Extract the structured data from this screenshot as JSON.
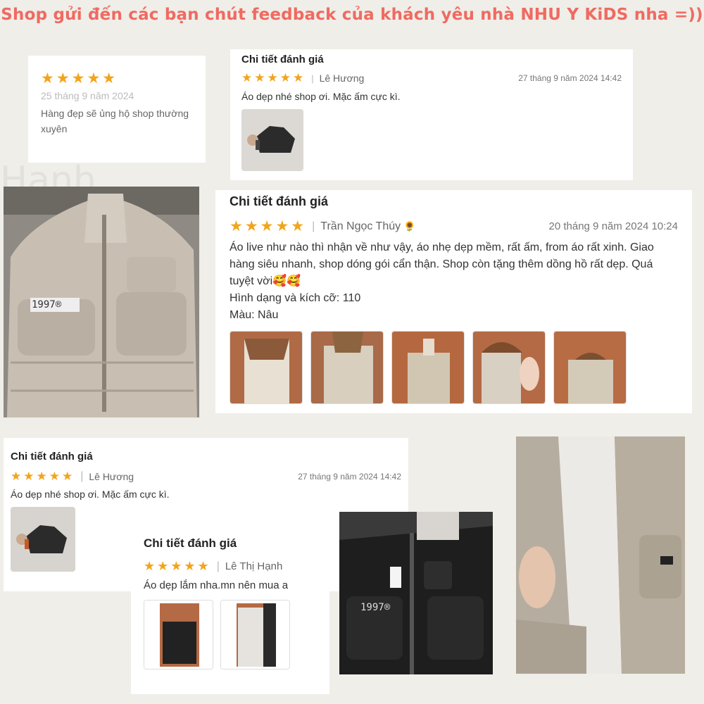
{
  "headline": "Shop gửi đến các bạn chút feedback của khách yêu nhà NHU Y KiDS nha =))",
  "review_small": {
    "stars": "★★★★★",
    "date": "25 tháng 9 năm 2024",
    "text": "Hàng đẹp sẽ ủng hộ shop thường xuyên"
  },
  "review_top": {
    "title": "Chi tiết đánh giá",
    "stars": "★★★★★",
    "user": "Lê Hương",
    "date": "27 tháng 9 năm 2024 14:42",
    "text": "Áo dẹp nhé shop ơi. Mặc ấm cực kì."
  },
  "review_main": {
    "title": "Chi tiết đánh giá",
    "stars": "★★★★★",
    "user": "Trần Ngọc Thúy",
    "user_emoji": "🌻",
    "date": "20 tháng 9 năm 2024 10:24",
    "text": "Áo live như nào thì nhận về như vậy, áo nhẹ dẹp mềm, rất ấm, from áo rất xinh. Giao hàng siêu nhanh, shop dóng gói cẩn thận. Shop còn tặng thêm dồng hồ rất dẹp. Quá tuyệt vời🥰🥰",
    "size": "Hình dạng và kích cỡ: 110",
    "color": "Màu: Nâu"
  },
  "review_left": {
    "title": "Chi tiết đánh giá",
    "stars": "★★★★★",
    "user": "Lê Hương",
    "date": "27 tháng 9 năm 2024 14:42",
    "text": "Áo dẹp nhé shop ơi. Mặc ấm cực kì."
  },
  "review_bottom": {
    "title": "Chi tiết đánh giá",
    "stars": "★★★★★",
    "user": "Lê Thị Hạnh",
    "text": "Áo dẹp lắm nha.mn nên mua a"
  },
  "jacket_print": "1997®",
  "colors": {
    "accent": "#f06a60",
    "star": "#f2a41a",
    "background": "#efeee9"
  }
}
